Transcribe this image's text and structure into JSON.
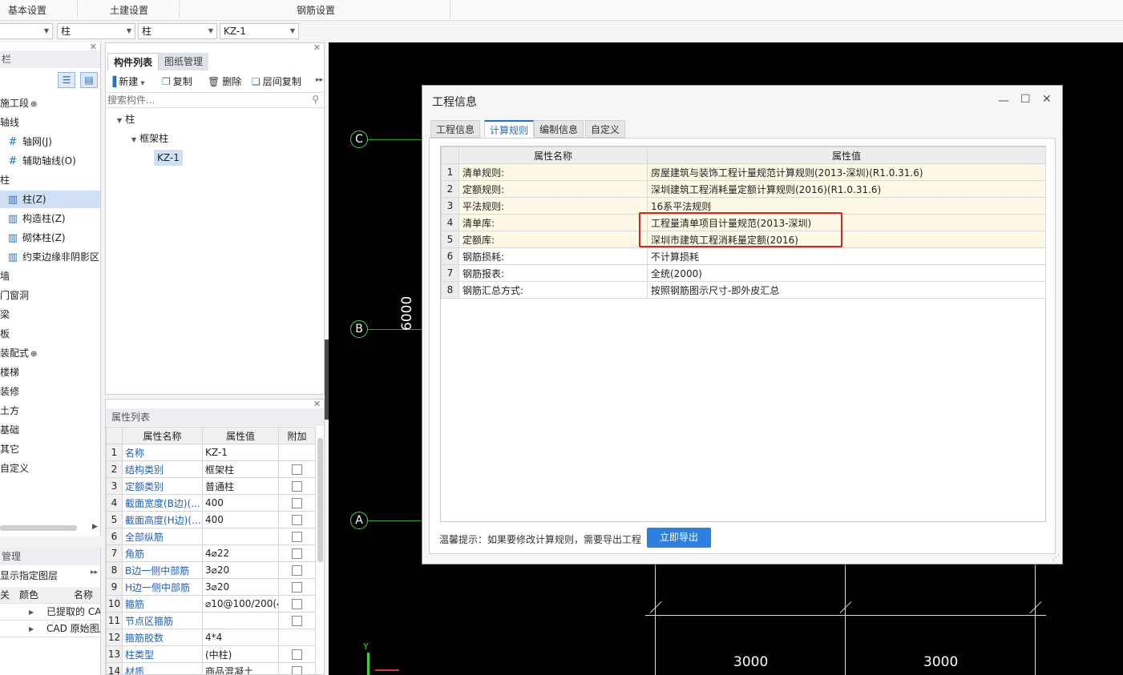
{
  "top_tabs": [
    "基本设置",
    "土建设置",
    "钢筋设置"
  ],
  "selectors": [
    "",
    "柱",
    "柱",
    "KZ-1"
  ],
  "nav": {
    "header": "栏",
    "items": [
      {
        "label": "施工段",
        "icon": "lock-icon",
        "suffix": "⊕"
      },
      {
        "label": "轴线"
      },
      {
        "label": "轴网(J)",
        "icon": "grid-icon"
      },
      {
        "label": "辅助轴线(O)",
        "icon": "grid-icon"
      },
      {
        "label": "柱"
      },
      {
        "label": "柱(Z)",
        "icon": "column-icon",
        "selected": true
      },
      {
        "label": "构造柱(Z)",
        "icon": "column-icon"
      },
      {
        "label": "砌体柱(Z)",
        "icon": "column-icon"
      },
      {
        "label": "约束边缘非阴影区",
        "icon": "column-icon"
      },
      {
        "label": "墙"
      },
      {
        "label": "门窗洞"
      },
      {
        "label": "梁"
      },
      {
        "label": "板"
      },
      {
        "label": "装配式",
        "suffix": "⊕"
      },
      {
        "label": "楼梯"
      },
      {
        "label": "装修"
      },
      {
        "label": "土方"
      },
      {
        "label": "基础"
      },
      {
        "label": "其它"
      },
      {
        "label": "自定义"
      }
    ]
  },
  "layer": {
    "header": "管理",
    "subheader": "显示指定图层",
    "cols": [
      "关",
      "颜色",
      "名称"
    ],
    "rows": [
      "已提取的 CA",
      "CAD 原始图层"
    ]
  },
  "comp": {
    "tabs": [
      "构件列表",
      "图纸管理"
    ],
    "tools": [
      "新建",
      "复制",
      "删除",
      "层间复制"
    ],
    "search_placeholder": "搜索构件...",
    "tree": [
      "柱",
      "框架柱",
      "KZ-1"
    ]
  },
  "props": {
    "header": "属性列表",
    "cols": [
      "属性名称",
      "属性值",
      "附加"
    ],
    "rows": [
      {
        "n": "1",
        "name": "名称",
        "val": "KZ-1",
        "cb": false
      },
      {
        "n": "2",
        "name": "结构类别",
        "val": "框架柱",
        "cb": true
      },
      {
        "n": "3",
        "name": "定额类别",
        "val": "普通柱",
        "cb": true
      },
      {
        "n": "4",
        "name": "截面宽度(B边)(...",
        "val": "400",
        "cb": true
      },
      {
        "n": "5",
        "name": "截面高度(H边)(...",
        "val": "400",
        "cb": true
      },
      {
        "n": "6",
        "name": "全部纵筋",
        "val": "",
        "cb": true
      },
      {
        "n": "7",
        "name": "角筋",
        "val": "4⌀22",
        "cb": true
      },
      {
        "n": "8",
        "name": "B边一侧中部筋",
        "val": "3⌀20",
        "cb": true
      },
      {
        "n": "9",
        "name": "H边一侧中部筋",
        "val": "3⌀20",
        "cb": true
      },
      {
        "n": "10",
        "name": "箍筋",
        "val": "⌀10@100/200(4",
        "cb": true
      },
      {
        "n": "11",
        "name": "节点区箍筋",
        "val": "",
        "cb": true
      },
      {
        "n": "12",
        "name": "箍筋胶数",
        "val": "4*4",
        "cb": false
      },
      {
        "n": "13",
        "name": "柱类型",
        "val": "(中柱)",
        "cb": true
      },
      {
        "n": "14",
        "name": "材质",
        "val": "商品混凝土",
        "cb": true
      }
    ]
  },
  "canvas": {
    "axes": [
      "C",
      "B",
      "A"
    ],
    "dim_vertical": "6000",
    "dim_bottom": [
      "3000",
      "3000"
    ],
    "ucs_y": "Y"
  },
  "dialog": {
    "title": "工程信息",
    "tabs": [
      "工程信息",
      "计算规则",
      "编制信息",
      "自定义"
    ],
    "cols": [
      "属性名称",
      "属性值"
    ],
    "rows": [
      {
        "n": "1",
        "name": "清单规则:",
        "val": "房屋建筑与装饰工程计量规范计算规则(2013-深圳)(R1.0.31.6)"
      },
      {
        "n": "2",
        "name": "定额规则:",
        "val": "深圳建筑工程消耗量定额计算规则(2016)(R1.0.31.6)"
      },
      {
        "n": "3",
        "name": "平法规则:",
        "val": "16系平法规则"
      },
      {
        "n": "4",
        "name": "清单库:",
        "val": "工程量清单项目计量规范(2013-深圳)"
      },
      {
        "n": "5",
        "name": "定额库:",
        "val": "深圳市建筑工程消耗量定额(2016)"
      },
      {
        "n": "6",
        "name": "钢筋损耗:",
        "val": "不计算损耗"
      },
      {
        "n": "7",
        "name": "钢筋报表:",
        "val": "全统(2000)"
      },
      {
        "n": "8",
        "name": "钢筋汇总方式:",
        "val": "按照钢筋图示尺寸-即外皮汇总"
      }
    ],
    "tip": "温馨提示：如果要修改计算规则，需要导出工程",
    "export_label": "立即导出",
    "accent": "#2d7fe0",
    "highlight_border": "#e0201c"
  }
}
